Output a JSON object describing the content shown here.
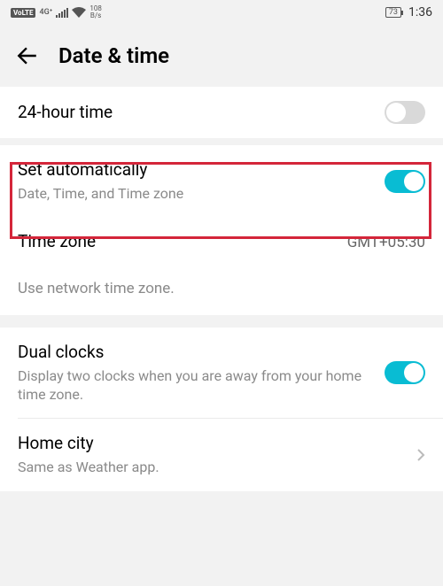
{
  "status": {
    "volte": "VoLTE",
    "net_gen": "4G⁺",
    "speed_top": "108",
    "speed_bot": "B/s",
    "battery": "73",
    "time": "1:36"
  },
  "header": {
    "title": "Date & time"
  },
  "section1": {
    "hour24": {
      "title": "24-hour time"
    }
  },
  "section2": {
    "auto": {
      "title": "Set automatically",
      "sub": "Date, Time, and Time zone"
    },
    "tz": {
      "title": "Time zone",
      "value": "GMT+05:30"
    },
    "note": "Use network time zone."
  },
  "section3": {
    "dual": {
      "title": "Dual clocks",
      "sub": "Display two clocks when you are away from your home time zone."
    },
    "home": {
      "title": "Home city",
      "sub": "Same as Weather app."
    }
  }
}
